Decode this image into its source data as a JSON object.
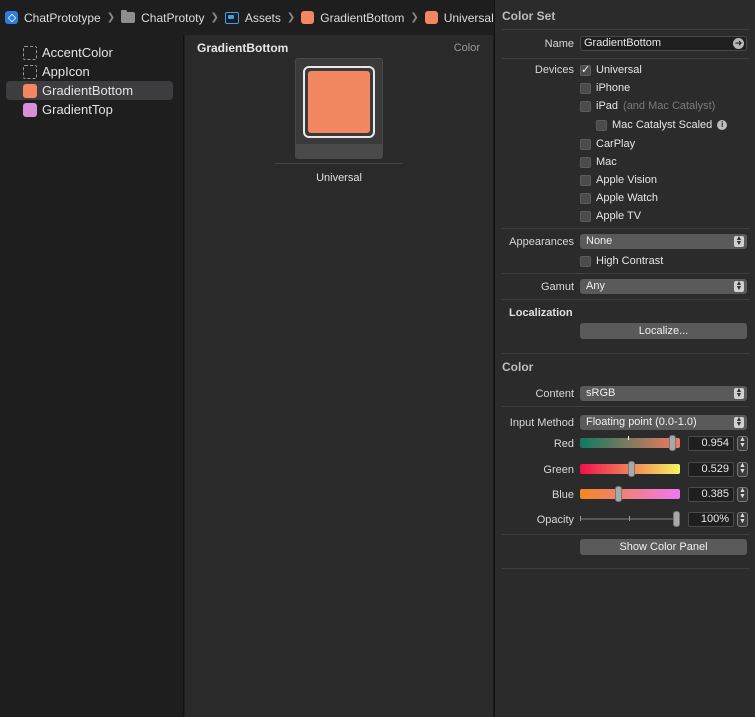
{
  "breadcrumb": {
    "project": "ChatPrototype",
    "folder": "ChatPrototy",
    "catalog": "Assets",
    "asset": "GradientBottom",
    "appearance": "Universal"
  },
  "sidebar": {
    "items": [
      {
        "label": "AccentColor"
      },
      {
        "label": "AppIcon"
      },
      {
        "label": "GradientBottom"
      },
      {
        "label": "GradientTop"
      }
    ]
  },
  "center": {
    "title": "GradientBottom",
    "type_label": "Color",
    "well_label": "Universal"
  },
  "colors": {
    "gradient_bottom": "#f38762",
    "gradient_top": "#d98fd8",
    "accent_blue": "#2f7ce0"
  },
  "inspector": {
    "color_set_title": "Color Set",
    "name_label": "Name",
    "name_value": "GradientBottom",
    "devices_label": "Devices",
    "devices": {
      "universal": "Universal",
      "iphone": "iPhone",
      "ipad": "iPad",
      "ipad_note": "(and Mac Catalyst)",
      "mac_catalyst_scaled": "Mac Catalyst Scaled",
      "carplay": "CarPlay",
      "mac": "Mac",
      "apple_vision": "Apple Vision",
      "apple_watch": "Apple Watch",
      "apple_tv": "Apple TV"
    },
    "appearances_label": "Appearances",
    "appearances_value": "None",
    "high_contrast": "High Contrast",
    "gamut_label": "Gamut",
    "gamut_value": "Any",
    "localization_title": "Localization",
    "localize_button": "Localize...",
    "color_title": "Color",
    "content_label": "Content",
    "content_value": "sRGB",
    "input_method_label": "Input Method",
    "input_method_value": "Floating point (0.0-1.0)",
    "red_label": "Red",
    "red_value": "0.954",
    "green_label": "Green",
    "green_value": "0.529",
    "blue_label": "Blue",
    "blue_value": "0.385",
    "opacity_label": "Opacity",
    "opacity_value": "100%",
    "show_color_panel": "Show Color Panel"
  }
}
